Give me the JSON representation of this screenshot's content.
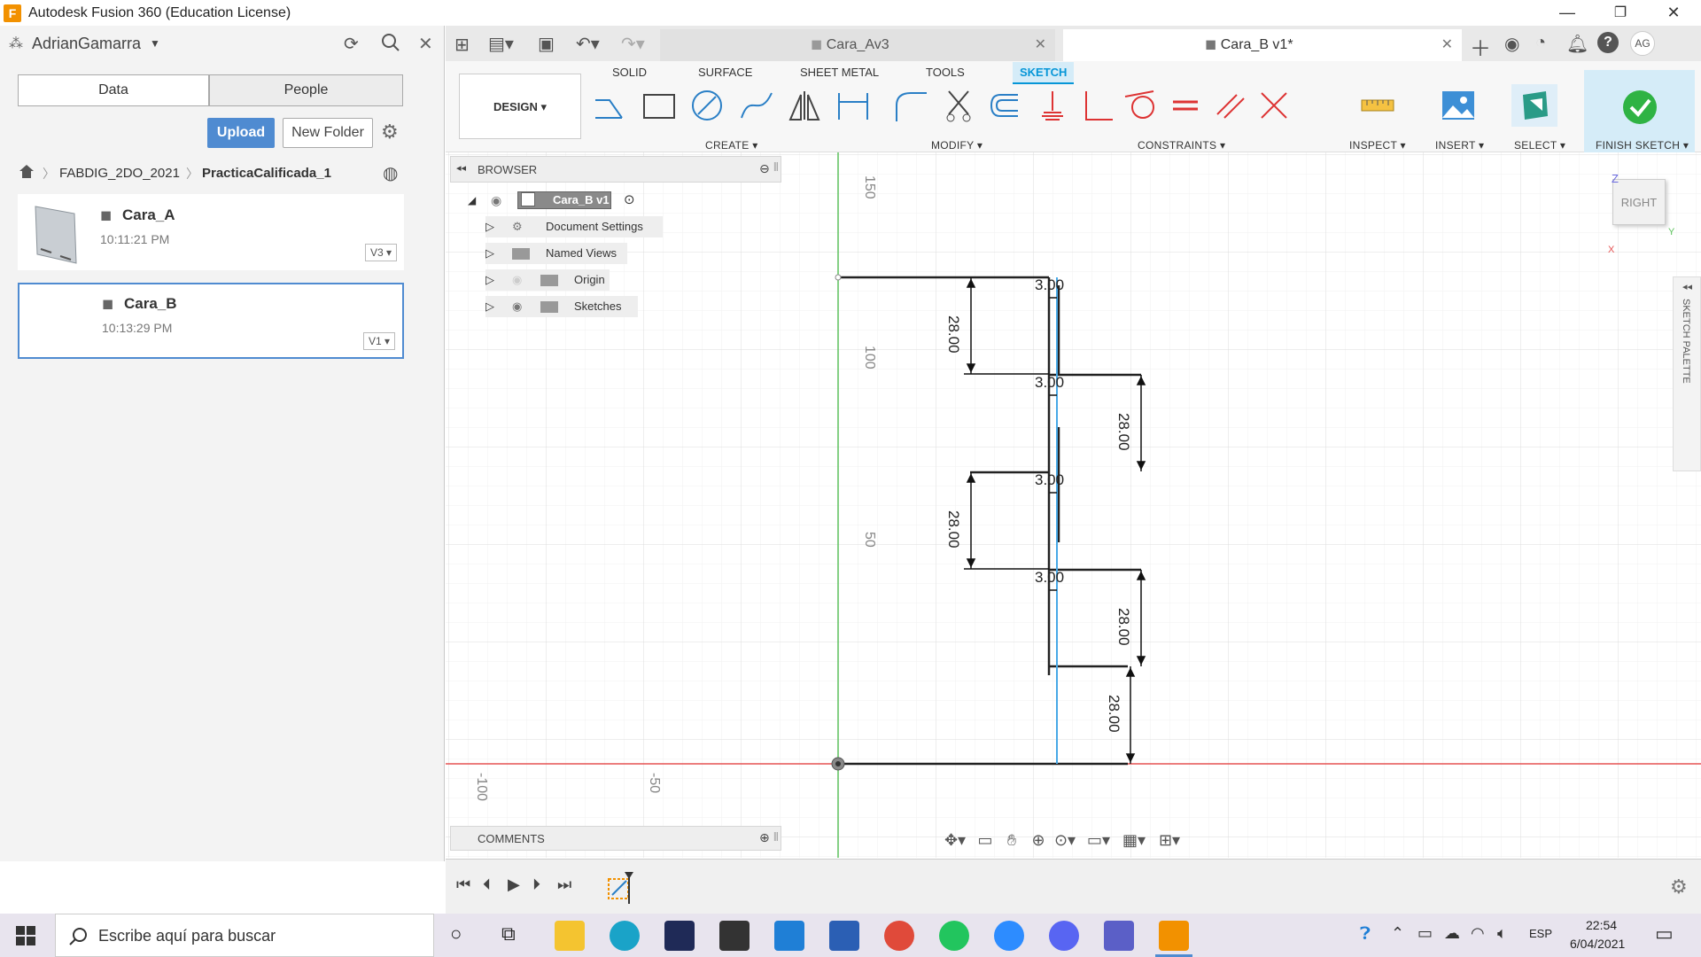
{
  "window": {
    "title": "Autodesk Fusion 360 (Education License)",
    "app_badge": "F",
    "minimize": "—",
    "restore": "❐",
    "close": "✕"
  },
  "left_panel": {
    "user": "AdrianGamarra",
    "tabs": [
      {
        "label": "Data",
        "selected": true
      },
      {
        "label": "People",
        "selected": false
      }
    ],
    "upload_label": "Upload",
    "new_folder_label": "New Folder",
    "breadcrumb": [
      "FABDIG_2DO_2021",
      "PracticaCalificada_1"
    ],
    "files": [
      {
        "name": "Cara_A",
        "time": "10:11:21 PM",
        "version": "V3"
      },
      {
        "name": "Cara_B",
        "time": "10:13:29 PM",
        "version": "V1"
      }
    ]
  },
  "document_tabs": [
    {
      "label": "Cara_Av3",
      "active": false
    },
    {
      "label": "Cara_B v1*",
      "active": true
    }
  ],
  "user_initials": "AG",
  "toolbar": {
    "workspace": "DESIGN",
    "tabs": [
      "SOLID",
      "SURFACE",
      "SHEET METAL",
      "TOOLS",
      "SKETCH"
    ],
    "active_tab": "SKETCH",
    "groups": [
      "CREATE",
      "MODIFY",
      "CONSTRAINTS",
      "INSPECT",
      "INSERT",
      "SELECT",
      "FINISH SKETCH"
    ]
  },
  "browser": {
    "title": "BROWSER",
    "root": "Cara_B v1",
    "items": [
      "Document Settings",
      "Named Views",
      "Origin",
      "Sketches"
    ]
  },
  "comments": {
    "title": "COMMENTS"
  },
  "viewcube": {
    "face": "RIGHT",
    "axis_z": "Z",
    "axis_y": "Y",
    "axis_x": "X"
  },
  "sketch_palette": "SKETCH PALETTE",
  "rulers": {
    "vertical": [
      "150",
      "100",
      "50"
    ],
    "horizontal": [
      "-100",
      "-50"
    ]
  },
  "dimensions": {
    "thickness": [
      "3.00",
      "3.00",
      "3.00",
      "3.00"
    ],
    "left_lengths": [
      "28.00",
      "28.00"
    ],
    "right_lengths": [
      "28.00",
      "28.00",
      "28.00"
    ]
  },
  "taskbar": {
    "search_placeholder": "Escribe aquí para buscar",
    "language": "ESP",
    "time": "22:54",
    "date": "6/04/2021"
  },
  "colors": {
    "accent": "#0696d7",
    "upload": "#4f8bd1",
    "axis_green": "#5cc15c",
    "axis_red": "#e55353",
    "sketch_blue": "#47a8e6"
  }
}
